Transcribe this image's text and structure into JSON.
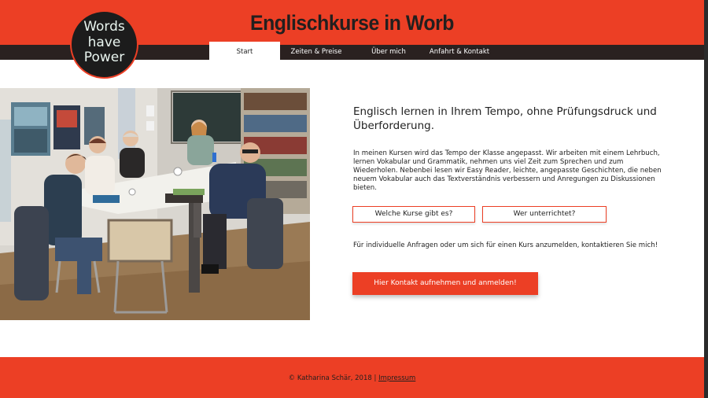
{
  "header": {
    "title": "Englischkurse in Worb",
    "logo": {
      "line1": "Words",
      "line2": "have",
      "line3": "Power"
    }
  },
  "nav": {
    "items": [
      {
        "label": "Start"
      },
      {
        "label": "Zeiten & Preise"
      },
      {
        "label": "Über mich"
      },
      {
        "label": "Anfahrt & Kontakt"
      }
    ]
  },
  "main": {
    "headline": "Englisch lernen in Ihrem Tempo, ohne Prüfungsdruck und Überforderung.",
    "intro": "In meinen Kursen wird das Tempo der Klasse angepasst. Wir arbeiten mit einem Lehrbuch, lernen Vokabular und Grammatik, nehmen uns viel Zeit zum Sprechen und zum Wiederholen. Nebenbei lesen wir Easy Reader, leichte, angepasste Geschichten, die neben neuem Vokabular auch das Textverständnis verbessern und Anregungen zu Diskussionen bieten.",
    "buttons": {
      "courses": "Welche Kurse gibt es?",
      "teacher": "Wer unterrichtet?"
    },
    "contact_text": "Für individuelle Anfragen oder um sich für einen Kurs anzumelden, kontaktieren Sie mich!",
    "cta": "Hier Kontakt aufnehmen und anmelden!"
  },
  "footer": {
    "copyright": "© Katharina Schär, 2018 | ",
    "impressum": "Impressum"
  },
  "colors": {
    "accent": "#ec3f25",
    "dark": "#2a2120",
    "logo_text": "#e9f5ef"
  }
}
